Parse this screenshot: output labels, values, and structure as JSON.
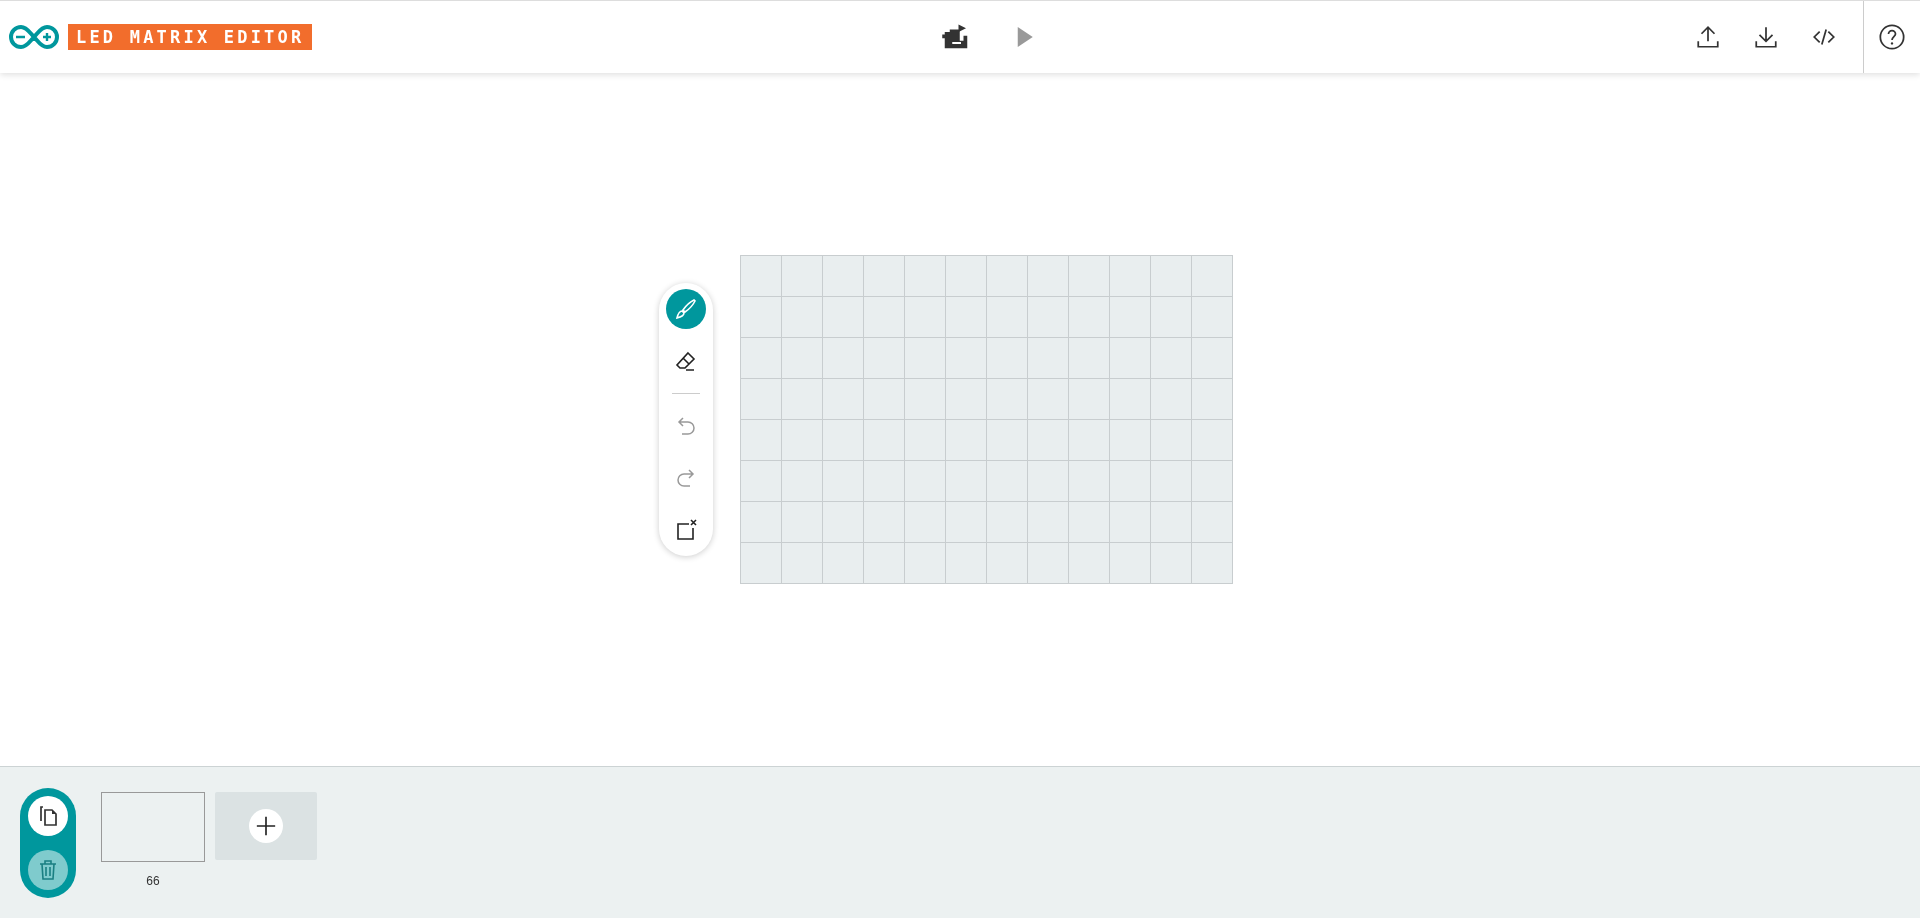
{
  "header": {
    "title": "LED MATRIX EDITOR",
    "actions": [
      {
        "kind": "upload"
      },
      {
        "kind": "download"
      },
      {
        "kind": "code"
      }
    ],
    "center": [
      {
        "kind": "sketch",
        "disabled": false
      },
      {
        "kind": "play",
        "disabled": true
      }
    ]
  },
  "tools": [
    {
      "kind": "brush",
      "selected": true,
      "disabled": false
    },
    {
      "kind": "eraser",
      "selected": false,
      "disabled": false
    },
    {
      "kind": "undo",
      "selected": false,
      "disabled": true
    },
    {
      "kind": "redo",
      "selected": false,
      "disabled": true
    },
    {
      "kind": "clear",
      "selected": false,
      "disabled": false
    }
  ],
  "matrix": [
    {
      "leds": [
        {
          "on": false
        },
        {
          "on": false
        },
        {
          "on": false
        },
        {
          "on": false
        },
        {
          "on": false
        },
        {
          "on": false
        },
        {
          "on": false
        },
        {
          "on": false
        },
        {
          "on": false
        },
        {
          "on": false
        },
        {
          "on": false
        },
        {
          "on": false
        }
      ]
    },
    {
      "leds": [
        {
          "on": false
        },
        {
          "on": false
        },
        {
          "on": false
        },
        {
          "on": false
        },
        {
          "on": false
        },
        {
          "on": false
        },
        {
          "on": false
        },
        {
          "on": false
        },
        {
          "on": false
        },
        {
          "on": false
        },
        {
          "on": false
        },
        {
          "on": false
        }
      ]
    },
    {
      "leds": [
        {
          "on": false
        },
        {
          "on": false
        },
        {
          "on": false
        },
        {
          "on": false
        },
        {
          "on": false
        },
        {
          "on": false
        },
        {
          "on": false
        },
        {
          "on": false
        },
        {
          "on": false
        },
        {
          "on": false
        },
        {
          "on": false
        },
        {
          "on": false
        }
      ]
    },
    {
      "leds": [
        {
          "on": false
        },
        {
          "on": false
        },
        {
          "on": false
        },
        {
          "on": false
        },
        {
          "on": false
        },
        {
          "on": false
        },
        {
          "on": false
        },
        {
          "on": false
        },
        {
          "on": false
        },
        {
          "on": false
        },
        {
          "on": false
        },
        {
          "on": false
        }
      ]
    },
    {
      "leds": [
        {
          "on": false
        },
        {
          "on": false
        },
        {
          "on": false
        },
        {
          "on": false
        },
        {
          "on": false
        },
        {
          "on": false
        },
        {
          "on": false
        },
        {
          "on": false
        },
        {
          "on": false
        },
        {
          "on": false
        },
        {
          "on": false
        },
        {
          "on": false
        }
      ]
    },
    {
      "leds": [
        {
          "on": false
        },
        {
          "on": false
        },
        {
          "on": false
        },
        {
          "on": false
        },
        {
          "on": false
        },
        {
          "on": false
        },
        {
          "on": false
        },
        {
          "on": false
        },
        {
          "on": false
        },
        {
          "on": false
        },
        {
          "on": false
        },
        {
          "on": false
        }
      ]
    },
    {
      "leds": [
        {
          "on": false
        },
        {
          "on": false
        },
        {
          "on": false
        },
        {
          "on": false
        },
        {
          "on": false
        },
        {
          "on": false
        },
        {
          "on": false
        },
        {
          "on": false
        },
        {
          "on": false
        },
        {
          "on": false
        },
        {
          "on": false
        },
        {
          "on": false
        }
      ]
    },
    {
      "leds": [
        {
          "on": false
        },
        {
          "on": false
        },
        {
          "on": false
        },
        {
          "on": false
        },
        {
          "on": false
        },
        {
          "on": false
        },
        {
          "on": false
        },
        {
          "on": false
        },
        {
          "on": false
        },
        {
          "on": false
        },
        {
          "on": false
        },
        {
          "on": false
        }
      ]
    }
  ],
  "frame_actions": [
    {
      "kind": "copy",
      "disabled": false
    },
    {
      "kind": "delete",
      "disabled": true
    }
  ],
  "frames": [
    {
      "label": "66",
      "selected": false
    }
  ]
}
